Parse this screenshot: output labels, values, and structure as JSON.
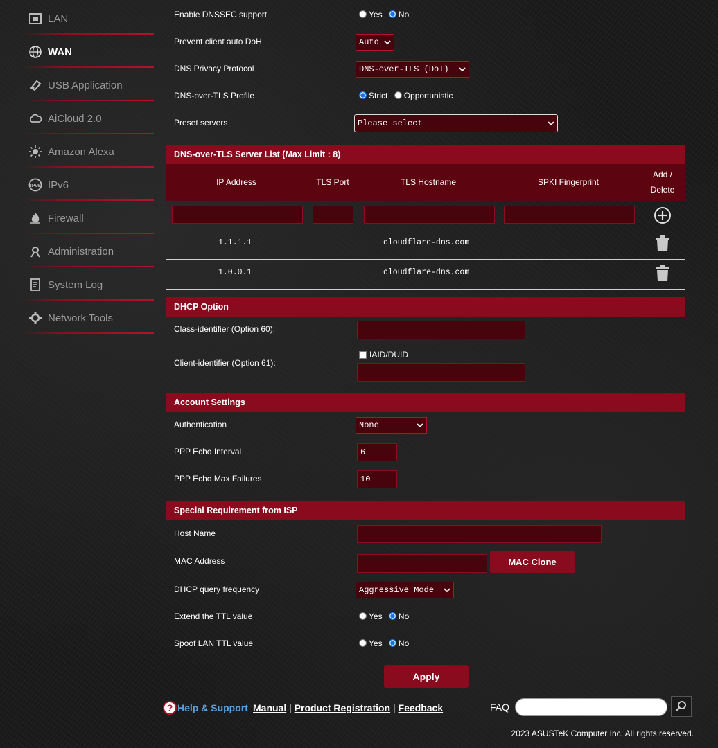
{
  "sidebar": {
    "items": [
      {
        "label": "LAN",
        "icon": "lan-icon"
      },
      {
        "label": "WAN",
        "icon": "globe-icon",
        "active": true
      },
      {
        "label": "USB Application",
        "icon": "usb-icon"
      },
      {
        "label": "AiCloud 2.0",
        "icon": "cloud-icon"
      },
      {
        "label": "Amazon Alexa",
        "icon": "alexa-icon"
      },
      {
        "label": "IPv6",
        "icon": "ipv6-icon"
      },
      {
        "label": "Firewall",
        "icon": "firewall-icon"
      },
      {
        "label": "Administration",
        "icon": "administration-icon"
      },
      {
        "label": "System Log",
        "icon": "system-log-icon"
      },
      {
        "label": "Network Tools",
        "icon": "network-tools-icon"
      }
    ]
  },
  "dns": {
    "dnssec_label": "Enable DNSSEC support",
    "dnssec_yes": "Yes",
    "dnssec_no": "No",
    "doh_label": "Prevent client auto DoH",
    "doh_value": "Auto",
    "privacy_label": "DNS Privacy Protocol",
    "privacy_value": "DNS-over-TLS (DoT)",
    "profile_label": "DNS-over-TLS Profile",
    "profile_strict": "Strict",
    "profile_opportunistic": "Opportunistic",
    "preset_label": "Preset servers",
    "preset_value": "Please select"
  },
  "dot_list": {
    "title": "DNS-over-TLS Server List (Max Limit : 8)",
    "columns": [
      "IP Address",
      "TLS Port",
      "TLS Hostname",
      "SPKI Fingerprint"
    ],
    "add_delete_1": "Add /",
    "add_delete_2": "Delete",
    "rows": [
      {
        "ip": "1.1.1.1",
        "port": "",
        "hostname": "cloudflare-dns.com",
        "spki": ""
      },
      {
        "ip": "1.0.0.1",
        "port": "",
        "hostname": "cloudflare-dns.com",
        "spki": ""
      }
    ]
  },
  "dhcp": {
    "title": "DHCP Option",
    "class_label": "Class-identifier (Option 60):",
    "client_label": "Client-identifier (Option 61):",
    "iaid_label": "IAID/DUID"
  },
  "account": {
    "title": "Account Settings",
    "auth_label": "Authentication",
    "auth_value": "None",
    "echo_interval_label": "PPP Echo Interval",
    "echo_interval_value": "6",
    "echo_fail_label": "PPP Echo Max Failures",
    "echo_fail_value": "10"
  },
  "isp": {
    "title": "Special Requirement from ISP",
    "host_label": "Host Name",
    "mac_label": "MAC Address",
    "mac_clone": "MAC Clone",
    "dhcp_freq_label": "DHCP query frequency",
    "dhcp_freq_value": "Aggressive Mode",
    "ttl_label": "Extend the TTL value",
    "spoof_label": "Spoof LAN TTL value",
    "yes": "Yes",
    "no": "No"
  },
  "apply": "Apply",
  "footer": {
    "help": "Help & Support",
    "manual": "Manual",
    "product_reg": "Product Registration",
    "feedback": "Feedback",
    "faq": "FAQ",
    "copyright": "2023 ASUSTeK Computer Inc. All rights reserved."
  },
  "colors": {
    "accent": "#8a0a1e",
    "header_dark": "#5c0510",
    "field_bg": "#47040c"
  }
}
